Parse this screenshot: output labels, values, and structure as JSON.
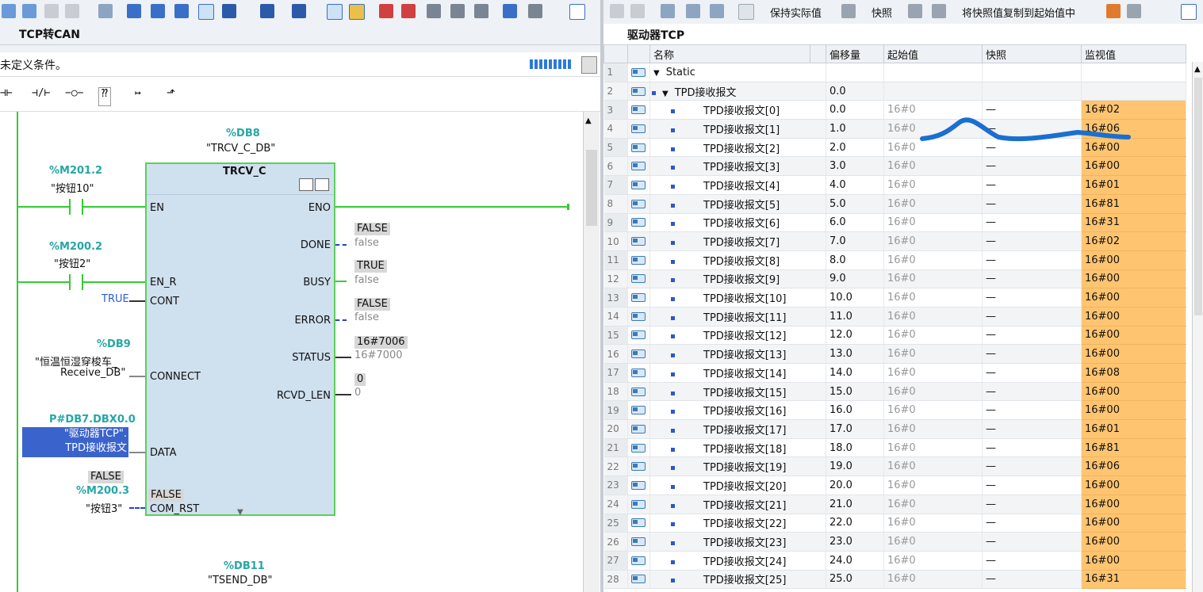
{
  "left": {
    "title": "TCP转CAN",
    "condition_text": "未定义条件。",
    "ladder_symbols": [
      "⊣⊢",
      "⊣/⊢",
      "−○−",
      "⁇",
      "↦",
      "⬏"
    ],
    "block": {
      "db_addr": "%DB8",
      "db_name": "\"TRCV_C_DB\"",
      "name": "TRCV_C",
      "pins_left": {
        "en": "EN",
        "en_r": "EN_R",
        "cont": "CONT",
        "connect": "CONNECT",
        "data": "DATA",
        "com_rst": "COM_RST"
      },
      "pins_right": {
        "eno": "ENO",
        "done": "DONE",
        "busy": "BUSY",
        "error": "ERROR",
        "status": "STATUS",
        "rcvd_len": "RCVD_LEN"
      },
      "inputs": {
        "en_addr": "%M201.2",
        "en_sym": "\"按钮10\"",
        "enr_addr": "%M200.2",
        "enr_sym": "\"按钮2\"",
        "cont_val": "TRUE",
        "connect_addr": "%DB9",
        "connect_sym1": "\"恒温恒湿穿梭车_",
        "connect_sym2": "Receive_DB\"",
        "data_addr": "P#DB7.DBX0.0",
        "data_sym1": "\"驱动器TCP\".",
        "data_sym2": "TPD接收报文",
        "comrst_mon": "FALSE",
        "comrst_addr": "%M200.3",
        "comrst_sym": "\"按钮3\"",
        "comrst_pin_val": "FALSE"
      },
      "outputs": {
        "done_mon": "FALSE",
        "done_val": "false",
        "busy_mon": "TRUE",
        "busy_val": "false",
        "error_mon": "FALSE",
        "error_val": "false",
        "status_mon": "16#7006",
        "status_val": "16#7000",
        "rcvd_mon": "0",
        "rcvd_val": "0"
      }
    },
    "next_block": {
      "db_addr": "%DB11",
      "db_name": "\"TSEND_DB\""
    }
  },
  "right": {
    "toolbar": {
      "keep_actual": "保持实际值",
      "snapshot": "快照",
      "copy_snapshot": "将快照值复制到起始值中"
    },
    "title": "驱动器TCP",
    "columns": {
      "name": "名称",
      "offset": "偏移量",
      "start": "起始值",
      "snapshot": "快照",
      "monitor": "监视值"
    },
    "rows": [
      {
        "idx": "1",
        "name": "Static",
        "level": 0,
        "expand": "▼",
        "offset": "",
        "start": "",
        "snap": "",
        "mon": ""
      },
      {
        "idx": "2",
        "name": "TPD接收报文",
        "level": 1,
        "expand": "▼",
        "offset": "0.0",
        "start": "",
        "snap": "",
        "mon": ""
      },
      {
        "idx": "3",
        "name": "TPD接收报文[0]",
        "level": 2,
        "offset": "0.0",
        "start": "16#0",
        "snap": "—",
        "mon": "16#02"
      },
      {
        "idx": "4",
        "name": "TPD接收报文[1]",
        "level": 2,
        "offset": "1.0",
        "start": "16#0",
        "snap": "—",
        "mon": "16#06"
      },
      {
        "idx": "5",
        "name": "TPD接收报文[2]",
        "level": 2,
        "offset": "2.0",
        "start": "16#0",
        "snap": "—",
        "mon": "16#00"
      },
      {
        "idx": "6",
        "name": "TPD接收报文[3]",
        "level": 2,
        "offset": "3.0",
        "start": "16#0",
        "snap": "—",
        "mon": "16#00"
      },
      {
        "idx": "7",
        "name": "TPD接收报文[4]",
        "level": 2,
        "offset": "4.0",
        "start": "16#0",
        "snap": "—",
        "mon": "16#01"
      },
      {
        "idx": "8",
        "name": "TPD接收报文[5]",
        "level": 2,
        "offset": "5.0",
        "start": "16#0",
        "snap": "—",
        "mon": "16#81"
      },
      {
        "idx": "9",
        "name": "TPD接收报文[6]",
        "level": 2,
        "offset": "6.0",
        "start": "16#0",
        "snap": "—",
        "mon": "16#31"
      },
      {
        "idx": "10",
        "name": "TPD接收报文[7]",
        "level": 2,
        "offset": "7.0",
        "start": "16#0",
        "snap": "—",
        "mon": "16#02"
      },
      {
        "idx": "11",
        "name": "TPD接收报文[8]",
        "level": 2,
        "offset": "8.0",
        "start": "16#0",
        "snap": "—",
        "mon": "16#00"
      },
      {
        "idx": "12",
        "name": "TPD接收报文[9]",
        "level": 2,
        "offset": "9.0",
        "start": "16#0",
        "snap": "—",
        "mon": "16#00"
      },
      {
        "idx": "13",
        "name": "TPD接收报文[10]",
        "level": 2,
        "offset": "10.0",
        "start": "16#0",
        "snap": "—",
        "mon": "16#00"
      },
      {
        "idx": "14",
        "name": "TPD接收报文[11]",
        "level": 2,
        "offset": "11.0",
        "start": "16#0",
        "snap": "—",
        "mon": "16#00"
      },
      {
        "idx": "15",
        "name": "TPD接收报文[12]",
        "level": 2,
        "offset": "12.0",
        "start": "16#0",
        "snap": "—",
        "mon": "16#00"
      },
      {
        "idx": "16",
        "name": "TPD接收报文[13]",
        "level": 2,
        "offset": "13.0",
        "start": "16#0",
        "snap": "—",
        "mon": "16#00"
      },
      {
        "idx": "17",
        "name": "TPD接收报文[14]",
        "level": 2,
        "offset": "14.0",
        "start": "16#0",
        "snap": "—",
        "mon": "16#08"
      },
      {
        "idx": "18",
        "name": "TPD接收报文[15]",
        "level": 2,
        "offset": "15.0",
        "start": "16#0",
        "snap": "—",
        "mon": "16#00"
      },
      {
        "idx": "19",
        "name": "TPD接收报文[16]",
        "level": 2,
        "offset": "16.0",
        "start": "16#0",
        "snap": "—",
        "mon": "16#00"
      },
      {
        "idx": "20",
        "name": "TPD接收报文[17]",
        "level": 2,
        "offset": "17.0",
        "start": "16#0",
        "snap": "—",
        "mon": "16#01"
      },
      {
        "idx": "21",
        "name": "TPD接收报文[18]",
        "level": 2,
        "offset": "18.0",
        "start": "16#0",
        "snap": "—",
        "mon": "16#81"
      },
      {
        "idx": "22",
        "name": "TPD接收报文[19]",
        "level": 2,
        "offset": "19.0",
        "start": "16#0",
        "snap": "—",
        "mon": "16#06"
      },
      {
        "idx": "23",
        "name": "TPD接收报文[20]",
        "level": 2,
        "offset": "20.0",
        "start": "16#0",
        "snap": "—",
        "mon": "16#00"
      },
      {
        "idx": "24",
        "name": "TPD接收报文[21]",
        "level": 2,
        "offset": "21.0",
        "start": "16#0",
        "snap": "—",
        "mon": "16#00"
      },
      {
        "idx": "25",
        "name": "TPD接收报文[22]",
        "level": 2,
        "offset": "22.0",
        "start": "16#0",
        "snap": "—",
        "mon": "16#00"
      },
      {
        "idx": "26",
        "name": "TPD接收报文[23]",
        "level": 2,
        "offset": "23.0",
        "start": "16#0",
        "snap": "—",
        "mon": "16#00"
      },
      {
        "idx": "27",
        "name": "TPD接收报文[24]",
        "level": 2,
        "offset": "24.0",
        "start": "16#0",
        "snap": "—",
        "mon": "16#00"
      },
      {
        "idx": "28",
        "name": "TPD接收报文[25]",
        "level": 2,
        "offset": "25.0",
        "start": "16#0",
        "snap": "—",
        "mon": "16#31"
      }
    ]
  },
  "colors": {
    "monitor_bg": "#ffc470",
    "wire_green": "#33cc33",
    "teal": "#26a6a6",
    "annotation_blue": "#1a6fd0"
  }
}
